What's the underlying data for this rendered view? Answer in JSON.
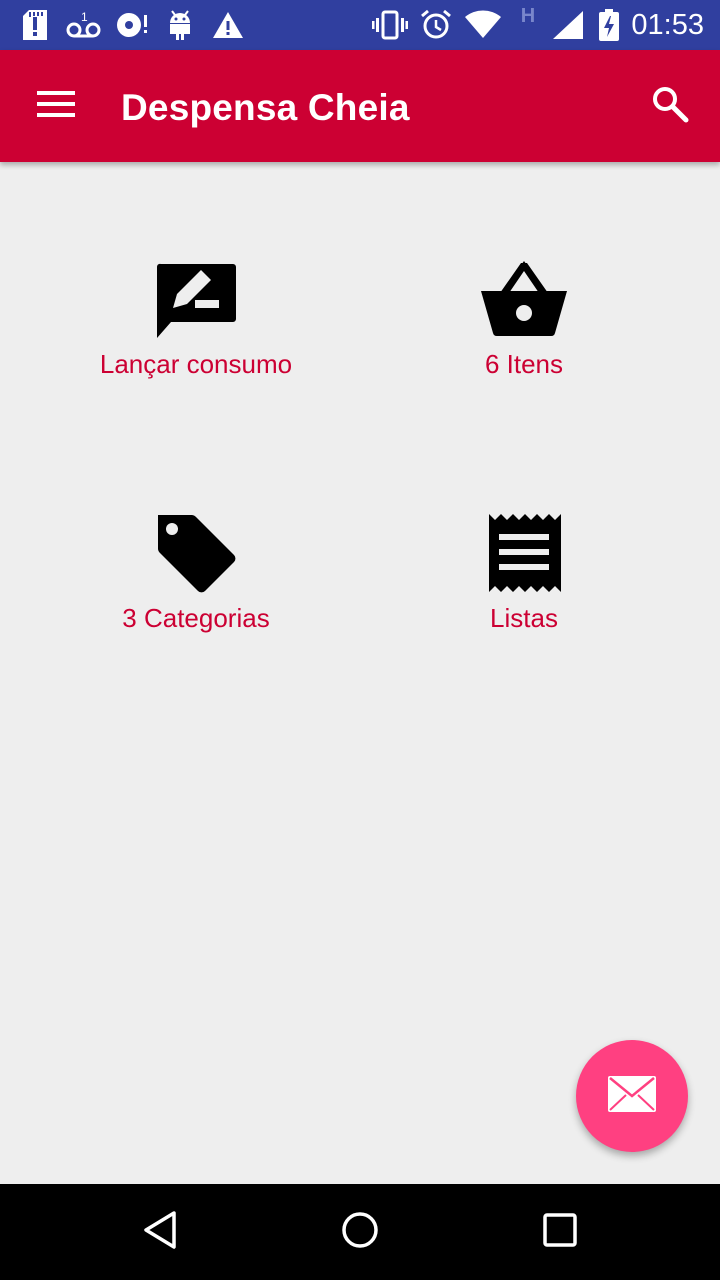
{
  "status_bar": {
    "time": "01:53",
    "network_type": "H",
    "icons": [
      "sd-card-alert-icon",
      "voicemail-icon",
      "disc-alert-icon",
      "android-icon",
      "warning-icon",
      "vibrate-icon",
      "alarm-icon",
      "wifi-icon",
      "signal-icon",
      "battery-charging-icon"
    ]
  },
  "app_bar": {
    "title": "Despensa Cheia",
    "menu_icon": "menu-icon",
    "search_icon": "search-icon",
    "background": "#cc0033"
  },
  "tiles": [
    {
      "label": "Lançar consumo",
      "icon": "rate-review-icon"
    },
    {
      "label": "6 Itens",
      "icon": "shopping-basket-icon"
    },
    {
      "label": "3 Categorias",
      "icon": "label-tag-icon"
    },
    {
      "label": "Listas",
      "icon": "receipt-icon"
    }
  ],
  "fab": {
    "icon": "email-icon",
    "color": "#ff4081"
  },
  "nav_bar": {
    "back_icon": "back-icon",
    "home_icon": "home-icon",
    "recents_icon": "recents-icon"
  },
  "colors": {
    "accent": "#cc0033",
    "status_bar": "#303f9f",
    "fab": "#ff4081",
    "background": "#eeeeee"
  }
}
